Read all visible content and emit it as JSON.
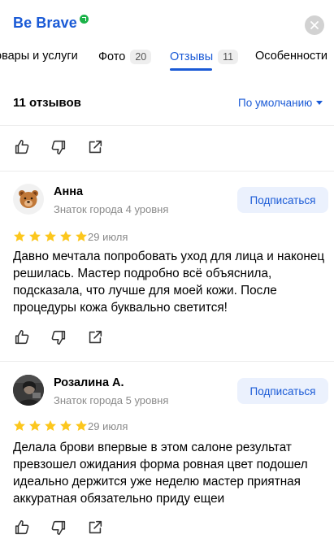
{
  "header": {
    "title": "Be Brave",
    "close_icon": "close-icon",
    "verified_icon": "verified-arrow-icon"
  },
  "tabs": [
    {
      "label": "Товары и услуги",
      "visible_label": "овары и услуги",
      "count": ""
    },
    {
      "label": "Фото",
      "count": "20"
    },
    {
      "label": "Отзывы",
      "count": "11",
      "active": true
    },
    {
      "label": "Особенности",
      "visible_label": "Особенности",
      "count": ""
    }
  ],
  "summary": {
    "reviews_count": "11 отзывов",
    "sort_label": "По умолчанию"
  },
  "reviews": [
    {
      "author": "Анна",
      "level": "Знаток города 4 уровня",
      "subscribe": "Подписаться",
      "rating": 5,
      "date": "29 июля",
      "text": "Давно мечтала попробовать уход для лица и наконец решилась. Мастер подробно всё объяснила, подсказала, что лучше для моей кожи. После процедуры кожа буквально светится!",
      "avatar": "bear-emoji"
    },
    {
      "author": "Розалина А.",
      "level": "Знаток города 5 уровня",
      "subscribe": "Подписаться",
      "rating": 5,
      "date": "29 июля",
      "text": "Делала брови впервые в этом салоне результат превзошел ожидания форма ровная цвет подошел идеально держится уже неделю мастер приятная аккуратная обязательно приду ещеи",
      "avatar": "user-photo"
    }
  ],
  "colors": {
    "accent": "#1a5ad6",
    "star": "#fcc71d",
    "verified": "#1ab248"
  }
}
